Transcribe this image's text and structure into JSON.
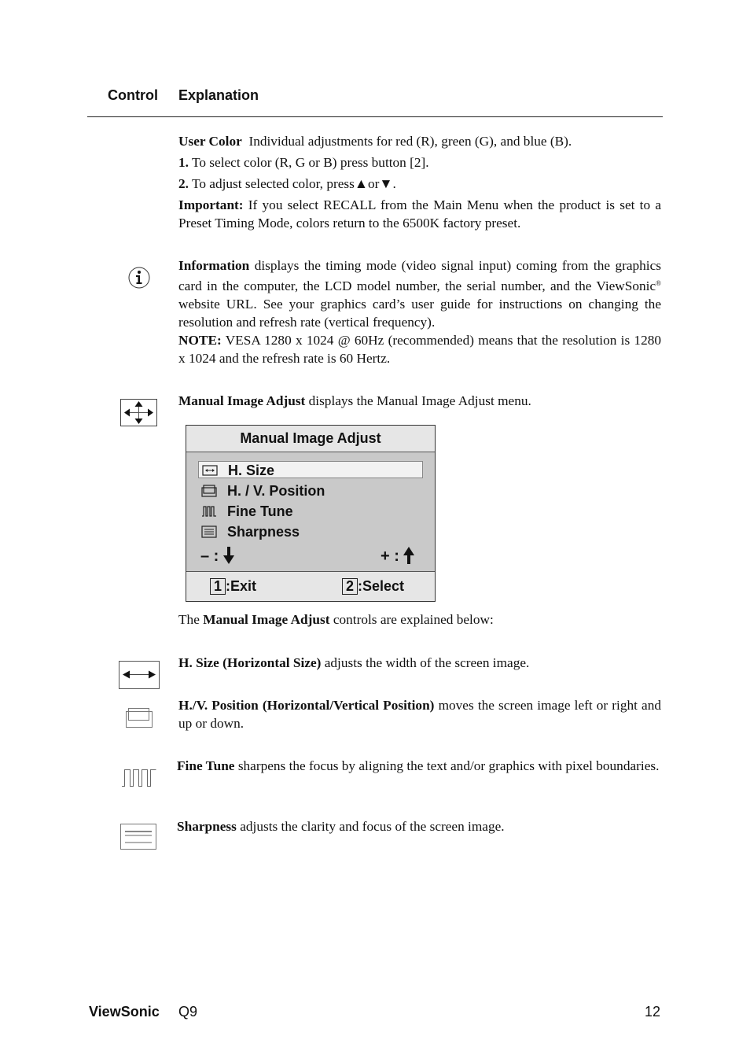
{
  "header": {
    "control_label": "Control",
    "explanation_label": "Explanation"
  },
  "user_color": {
    "title": "User Color",
    "intro": "Individual adjustments for red (R), green (G),  and blue (B).",
    "step1_num": "1.",
    "step1_text": "To select color (R, G or B) press button [2].",
    "step2_num": "2.",
    "step2_text": "To adjust selected color, press",
    "step2_up_icon": "▲",
    "step2_or": "or",
    "step2_down_icon": "▼",
    "step2_end": ".",
    "important_label": "Important:",
    "important_text": "If you select RECALL from the Main Menu when the product is set to a Preset Timing Mode, colors return to the 6500K factory preset."
  },
  "information": {
    "icon": "info-icon",
    "title": "Information",
    "text_a": "displays the timing mode (video signal input) coming from the graphics card in the computer, the LCD model number, the serial number, and the ViewSonic",
    "registered": "®",
    "text_b": "website URL. See your graphics card’s user guide for instructions on changing the resolution and refresh rate (vertical frequency).",
    "note_label": "NOTE:",
    "note_text": "VESA 1280 x 1024 @ 60Hz (recommended) means that the resolution is 1280 x 1024 and the refresh rate is 60 Hertz."
  },
  "manual_image_adjust": {
    "icon": "four-way-arrows-icon",
    "title": "Manual Image Adjust",
    "text": "displays the Manual Image Adjust menu.",
    "osd": {
      "title": "Manual Image Adjust",
      "items": [
        {
          "label": "H. Size",
          "icon": "h-size-icon",
          "selected": true
        },
        {
          "label": "H. / V. Position",
          "icon": "hv-position-icon",
          "selected": false
        },
        {
          "label": "Fine Tune",
          "icon": "fine-tune-icon",
          "selected": false
        },
        {
          "label": "Sharpness",
          "icon": "sharpness-icon",
          "selected": false
        }
      ],
      "minus_label": "– :",
      "plus_label": "+ :",
      "exit_key": "1",
      "exit_label": ":Exit",
      "select_key": "2",
      "select_label": ":Select"
    },
    "explained_prefix": "The",
    "explained_bold": "Manual Image Adjust",
    "explained_suffix": "controls are explained below:"
  },
  "controls": [
    {
      "icon": "h-size-icon",
      "title": "H. Size (Horizontal Size)",
      "text": "adjusts the width of the screen image."
    },
    {
      "icon": "hv-position-icon",
      "title": "H./V. Position (Horizontal/Vertical Position)",
      "text": "moves the screen image left or right and up or down."
    },
    {
      "icon": "fine-tune-icon",
      "title": "Fine Tune",
      "text": "sharpens the focus by aligning the text and/or graphics with pixel boundaries."
    },
    {
      "icon": "sharpness-icon",
      "title": "Sharpness",
      "text": "adjusts the clarity and focus of the screen image."
    }
  ],
  "footer": {
    "brand": "ViewSonic",
    "model": "Q9",
    "page": "12"
  }
}
